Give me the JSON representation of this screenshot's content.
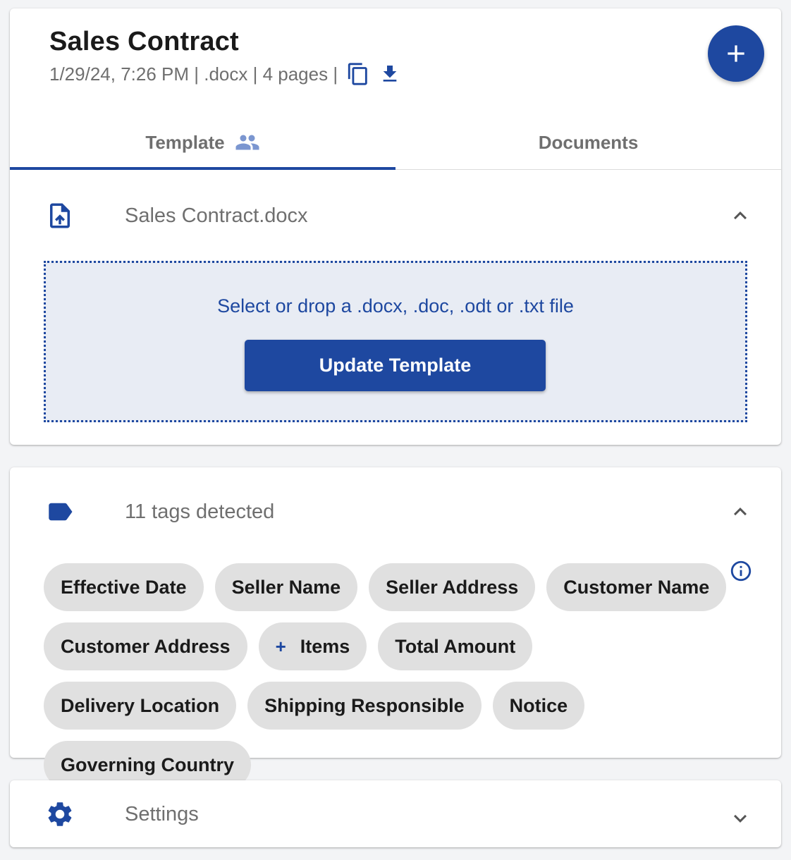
{
  "header": {
    "title": "Sales Contract",
    "meta": "1/29/24, 7:26 PM | .docx | 4 pages |",
    "icons": [
      "copy-icon",
      "download-icon"
    ],
    "fab_icon": "plus-icon"
  },
  "tabs": [
    {
      "label": "Template",
      "icon": "people-icon",
      "active": true
    },
    {
      "label": "Documents",
      "active": false
    }
  ],
  "template_section": {
    "icon": "file-upload-icon",
    "filename": "Sales Contract.docx",
    "expanded": true,
    "dropzone_hint": "Select or drop a .docx, .doc, .odt or .txt file",
    "update_button": "Update Template"
  },
  "tags_section": {
    "icon": "label-icon",
    "label": "11 tags detected",
    "expanded": true,
    "info_icon": "info-icon",
    "tags": [
      {
        "label": "Effective Date"
      },
      {
        "label": "Seller Name"
      },
      {
        "label": "Seller Address"
      },
      {
        "label": "Customer Name"
      },
      {
        "label": "Customer Address"
      },
      {
        "label": "Items",
        "prefix": "+"
      },
      {
        "label": "Total Amount"
      },
      {
        "label": "Delivery Location"
      },
      {
        "label": "Shipping Responsible"
      },
      {
        "label": "Notice"
      },
      {
        "label": "Governing Country"
      }
    ]
  },
  "settings_section": {
    "icon": "gear-icon",
    "label": "Settings",
    "expanded": false
  },
  "colors": {
    "accent": "#1e48a0",
    "chip_bg": "#e0e0e0",
    "dropzone_bg": "#e8ecf4",
    "muted_text": "#6f6f6f"
  }
}
